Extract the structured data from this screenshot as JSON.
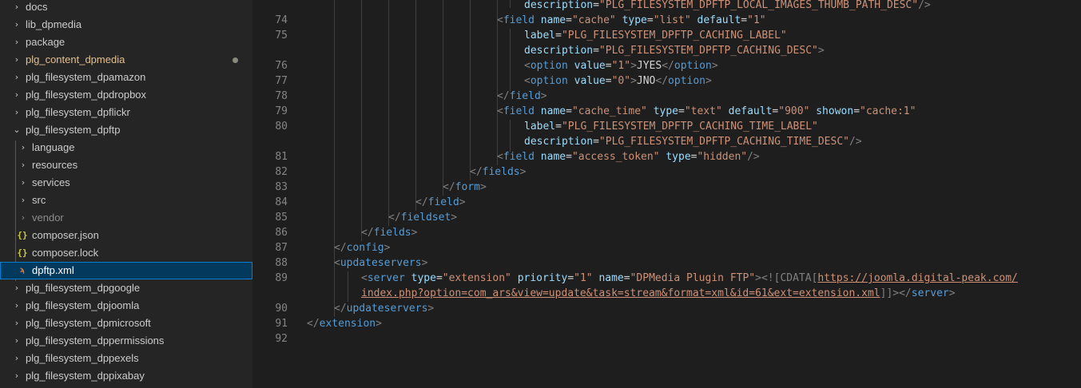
{
  "explorer": {
    "items": [
      {
        "label": "docs"
      },
      {
        "label": "lib_dpmedia"
      },
      {
        "label": "package"
      },
      {
        "label": "plg_content_dpmedia"
      },
      {
        "label": "plg_filesystem_dpamazon"
      },
      {
        "label": "plg_filesystem_dpdropbox"
      },
      {
        "label": "plg_filesystem_dpflickr"
      },
      {
        "label": "plg_filesystem_dpftp"
      },
      {
        "label": "language"
      },
      {
        "label": "resources"
      },
      {
        "label": "services"
      },
      {
        "label": "src"
      },
      {
        "label": "vendor"
      },
      {
        "label": "composer.json"
      },
      {
        "label": "composer.lock"
      },
      {
        "label": "dpftp.xml"
      },
      {
        "label": "plg_filesystem_dpgoogle"
      },
      {
        "label": "plg_filesystem_dpjoomla"
      },
      {
        "label": "plg_filesystem_dpmicrosoft"
      },
      {
        "label": "plg_filesystem_dppermissions"
      },
      {
        "label": "plg_filesystem_dppexels"
      },
      {
        "label": "plg_filesystem_dppixabay"
      }
    ],
    "selected": "dpftp.xml",
    "colors": {
      "modified": "#e2c08d",
      "json_icon": "#cbcb41",
      "xml_icon": "#e37933"
    }
  },
  "editor": {
    "line_numbers": [
      "74",
      "75",
      "76",
      "77",
      "78",
      "79",
      "80",
      "81",
      "82",
      "83",
      "84",
      "85",
      "86",
      "87",
      "88",
      "89",
      "90",
      "91",
      "92"
    ],
    "lines": {
      "l0_attr": "description",
      "l0_val": "\"PLG_FILESYSTEM_DPFTP_LOCAL_IMAGES_THUMB_PATH_DESC\"",
      "l1_tag": "field",
      "l1_a1": "name",
      "l1_v1": "\"cache\"",
      "l1_a2": "type",
      "l1_v2": "\"list\"",
      "l1_a3": "default",
      "l1_v3": "\"1\"",
      "l2_attr": "label",
      "l2_val": "\"PLG_FILESYSTEM_DPFTP_CACHING_LABEL\"",
      "l3_attr": "description",
      "l3_val": "\"PLG_FILESYSTEM_DPFTP_CACHING_DESC\"",
      "l4_tag": "option",
      "l4_a": "value",
      "l4_v": "\"1\"",
      "l4_text": "JYES",
      "l5_tag": "option",
      "l5_a": "value",
      "l5_v": "\"0\"",
      "l5_text": "JNO",
      "l6_tag": "field",
      "l7_tag": "field",
      "l7_a1": "name",
      "l7_v1": "\"cache_time\"",
      "l7_a2": "type",
      "l7_v2": "\"text\"",
      "l7_a3": "default",
      "l7_v3": "\"900\"",
      "l7_a4": "showon",
      "l7_v4": "\"cache:1\"",
      "l8_attr": "label",
      "l8_val": "\"PLG_FILESYSTEM_DPFTP_CACHING_TIME_LABEL\"",
      "l9_attr": "description",
      "l9_val": "\"PLG_FILESYSTEM_DPFTP_CACHING_TIME_DESC\"",
      "l10_tag": "field",
      "l10_a1": "name",
      "l10_v1": "\"access_token\"",
      "l10_a2": "type",
      "l10_v2": "\"hidden\"",
      "l11_tag": "fields",
      "l12_tag": "form",
      "l13_tag": "field",
      "l14_tag": "fieldset",
      "l15_tag": "fields",
      "l16_tag": "config",
      "l17_tag": "updateservers",
      "l18_tag": "server",
      "l18_a1": "type",
      "l18_v1": "\"extension\"",
      "l18_a2": "priority",
      "l18_v2": "\"1\"",
      "l18_a3": "name",
      "l18_v3": "\"DPMedia Plugin FTP\"",
      "l18_cdata": "<![CDATA[",
      "l18_url": "https://joomla.digital-peak.com/",
      "l19_url": "index.php?option=com_ars&view=update&task=stream&format=xml&id=61&ext=extension.xml",
      "l19_cdata_end": "]]>",
      "l19_tag": "server",
      "l20_tag": "updateservers",
      "l21_tag": "extension"
    }
  }
}
